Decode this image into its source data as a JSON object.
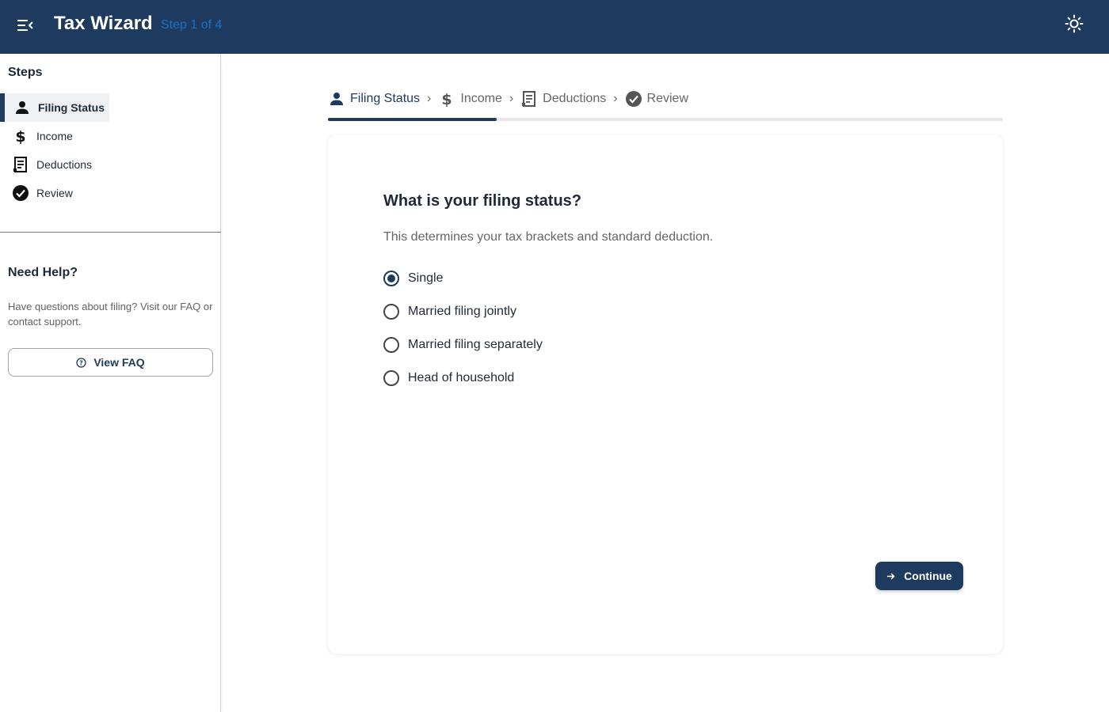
{
  "header": {
    "app_title": "Tax Wizard",
    "step_label": "Step 1 of 4",
    "menu_icon": "menu-open-icon",
    "theme_icon": "sun-icon",
    "background_color": "#1e3a5f",
    "step_label_color": "#1a73c8"
  },
  "sidebar": {
    "heading": "Steps",
    "items": [
      {
        "label": "Filing Status",
        "icon": "person-icon",
        "active": true
      },
      {
        "label": "Income",
        "icon": "dollar-icon",
        "active": false
      },
      {
        "label": "Deductions",
        "icon": "receipt-icon",
        "active": false
      },
      {
        "label": "Review",
        "icon": "check-circle-icon",
        "active": false
      }
    ],
    "help": {
      "title": "Need Help?",
      "text": "Have questions about filing? Visit our FAQ or contact support.",
      "button_label": "View FAQ",
      "button_icon": "help-circle-icon"
    }
  },
  "stepper": {
    "steps": [
      {
        "label": "Filing Status",
        "icon": "person-icon",
        "active": true
      },
      {
        "label": "Income",
        "icon": "dollar-icon",
        "active": false
      },
      {
        "label": "Deductions",
        "icon": "receipt-icon",
        "active": false
      },
      {
        "label": "Review",
        "icon": "check-circle-icon",
        "active": false
      }
    ],
    "separator": "›",
    "progress_fraction": 0.25
  },
  "form": {
    "question": "What is your filing status?",
    "description": "This determines your tax brackets and standard deduction.",
    "options": [
      {
        "label": "Single",
        "selected": true
      },
      {
        "label": "Married filing jointly",
        "selected": false
      },
      {
        "label": "Married filing separately",
        "selected": false
      },
      {
        "label": "Head of household",
        "selected": false
      }
    ],
    "continue_label": "Continue",
    "continue_icon": "arrow-right-icon",
    "accent_color": "#1e3a5f"
  }
}
